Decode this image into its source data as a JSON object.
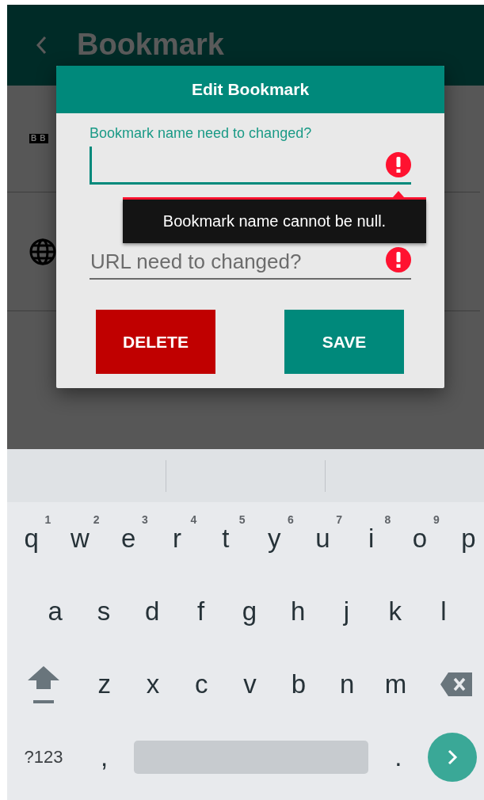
{
  "app_bar": {
    "title": "Bookmark"
  },
  "background_list": [
    {
      "kind": "logo",
      "text": "BB"
    },
    {
      "kind": "globe"
    }
  ],
  "dialog": {
    "title": "Edit Bookmark",
    "name_field": {
      "label": "Bookmark name need to changed?",
      "focused": true,
      "error": true
    },
    "error_tooltip": "Bookmark name cannot be null.",
    "url_field": {
      "placeholder": "URL need to changed?",
      "focused": false,
      "error": true
    },
    "buttons": [
      {
        "label": "DELETE",
        "kind": "danger"
      },
      {
        "label": "SAVE",
        "kind": "primary"
      }
    ]
  },
  "keyboard": {
    "rows": [
      {
        "keys": [
          {
            "kind": "letter",
            "label": "q",
            "hint": "1"
          },
          {
            "kind": "letter",
            "label": "w",
            "hint": "2"
          },
          {
            "kind": "letter",
            "label": "e",
            "hint": "3"
          },
          {
            "kind": "letter",
            "label": "r",
            "hint": "4"
          },
          {
            "kind": "letter",
            "label": "t",
            "hint": "5"
          },
          {
            "kind": "letter",
            "label": "y",
            "hint": "6"
          },
          {
            "kind": "letter",
            "label": "u",
            "hint": "7"
          },
          {
            "kind": "letter",
            "label": "i",
            "hint": "8"
          },
          {
            "kind": "letter",
            "label": "o",
            "hint": "9"
          },
          {
            "kind": "letter",
            "label": "p"
          }
        ]
      },
      {
        "keys": [
          {
            "kind": "letter",
            "label": "a"
          },
          {
            "kind": "letter",
            "label": "s"
          },
          {
            "kind": "letter",
            "label": "d"
          },
          {
            "kind": "letter",
            "label": "f"
          },
          {
            "kind": "letter",
            "label": "g"
          },
          {
            "kind": "letter",
            "label": "h"
          },
          {
            "kind": "letter",
            "label": "j"
          },
          {
            "kind": "letter",
            "label": "k"
          },
          {
            "kind": "letter",
            "label": "l"
          }
        ]
      },
      {
        "keys": [
          {
            "kind": "shift"
          },
          {
            "kind": "letter",
            "label": "z"
          },
          {
            "kind": "letter",
            "label": "x"
          },
          {
            "kind": "letter",
            "label": "c"
          },
          {
            "kind": "letter",
            "label": "v"
          },
          {
            "kind": "letter",
            "label": "b"
          },
          {
            "kind": "letter",
            "label": "n"
          },
          {
            "kind": "letter",
            "label": "m"
          },
          {
            "kind": "backspace"
          }
        ]
      }
    ],
    "bottom_row": {
      "symbols_key": "?123",
      "comma_key": ",",
      "period_key": "."
    }
  }
}
